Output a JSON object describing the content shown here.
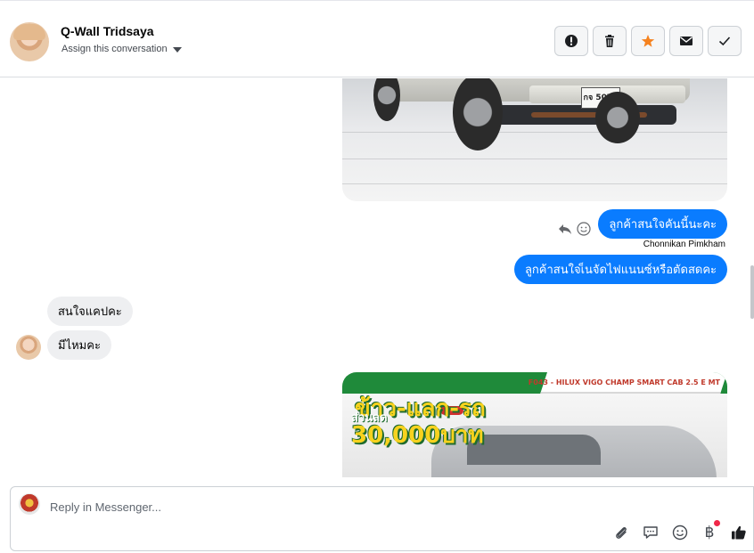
{
  "header": {
    "contact_name": "Q-Wall Tridsaya",
    "assign_label": "Assign this conversation",
    "actions": [
      {
        "name": "spam-button",
        "icon": "alert-icon"
      },
      {
        "name": "delete-button",
        "icon": "trash-icon"
      },
      {
        "name": "star-button",
        "icon": "star-icon",
        "color": "#f5821f"
      },
      {
        "name": "mark-unread-button",
        "icon": "envelope-icon"
      },
      {
        "name": "mark-done-button",
        "icon": "check-icon"
      }
    ]
  },
  "thread": {
    "car_photo_1": {
      "plate": "กจ 5073"
    },
    "outgoing": [
      {
        "text": "ลูกค้าสนใจคันนี้นะคะ",
        "sender": "Chonnikan Pimkham"
      },
      {
        "text": "ลูกค้าสนใจเ็นจัดไฟแนนซ์หรือตัดสดคะ"
      }
    ],
    "incoming": [
      {
        "text": "สนใจแคปคะ"
      },
      {
        "text": "มีไหมคะ"
      }
    ],
    "ad_image": {
      "model_label": "F043 - HILUX VIGO CHAMP SMART CAB 2.5 E MT",
      "promo_line1": "ข้าว-แลก-รถ",
      "promo_line2": "ส่วนลด",
      "promo_line3": "30,000บาท"
    }
  },
  "composer": {
    "placeholder": "Reply in Messenger...",
    "value": "",
    "tools": [
      "paperclip-icon",
      "saved-reply-icon",
      "emoji-icon",
      "baht-icon",
      "thumbs-up-icon"
    ],
    "baht_symbol": "฿"
  },
  "colors": {
    "outgoing_bubble": "#0a7cff",
    "incoming_bubble": "#eeeff1",
    "notification_dot": "#f02849",
    "star": "#f5821f"
  }
}
